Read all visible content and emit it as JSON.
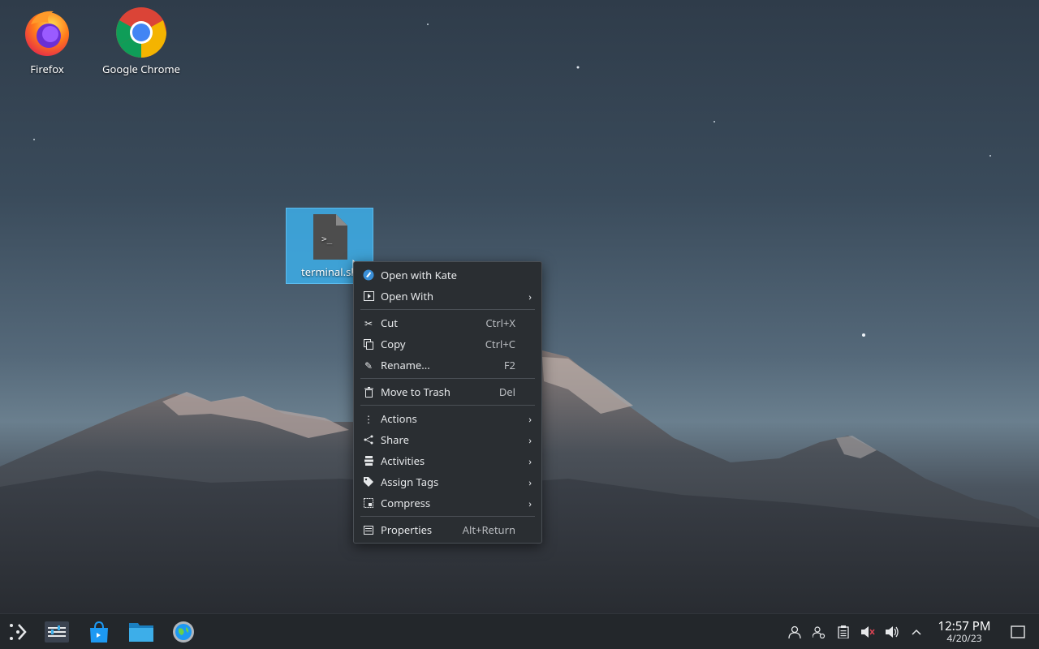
{
  "desktop": {
    "icons": [
      {
        "label": "Firefox"
      },
      {
        "label": "Google Chrome"
      },
      {
        "label": "terminal.sh"
      }
    ]
  },
  "context_menu": {
    "items": [
      {
        "label": "Open with Kate",
        "shortcut": "",
        "icon": "kate-icon",
        "submenu": false
      },
      {
        "label": "Open With",
        "shortcut": "",
        "icon": "open-with-icon",
        "submenu": true
      },
      {
        "label": "Cut",
        "shortcut": "Ctrl+X",
        "icon": "cut-icon",
        "submenu": false
      },
      {
        "label": "Copy",
        "shortcut": "Ctrl+C",
        "icon": "copy-icon",
        "submenu": false
      },
      {
        "label": "Rename...",
        "shortcut": "F2",
        "icon": "rename-icon",
        "submenu": false
      },
      {
        "label": "Move to Trash",
        "shortcut": "Del",
        "icon": "trash-icon",
        "submenu": false
      },
      {
        "label": "Actions",
        "shortcut": "",
        "icon": "actions-icon",
        "submenu": true
      },
      {
        "label": "Share",
        "shortcut": "",
        "icon": "share-icon",
        "submenu": true
      },
      {
        "label": "Activities",
        "shortcut": "",
        "icon": "activities-icon",
        "submenu": true
      },
      {
        "label": "Assign Tags",
        "shortcut": "",
        "icon": "tag-icon",
        "submenu": true
      },
      {
        "label": "Compress",
        "shortcut": "",
        "icon": "compress-icon",
        "submenu": true
      },
      {
        "label": "Properties",
        "shortcut": "Alt+Return",
        "icon": "properties-icon",
        "submenu": false
      }
    ]
  },
  "taskbar": {
    "launchers": [
      "application-launcher-icon",
      "system-settings-icon",
      "discover-store-icon",
      "file-manager-icon",
      "kde-connect-globe-icon"
    ],
    "tray": [
      "user-icon",
      "user-switch-icon",
      "clipboard-icon",
      "audio-muted-icon",
      "volume-icon",
      "expand-tray-icon"
    ],
    "clock": {
      "time": "12:57 PM",
      "date": "4/20/23"
    }
  },
  "colors": {
    "selection": "#3daee9",
    "menu_bg": "#2a2e32",
    "taskbar_bg": "#23272b"
  }
}
